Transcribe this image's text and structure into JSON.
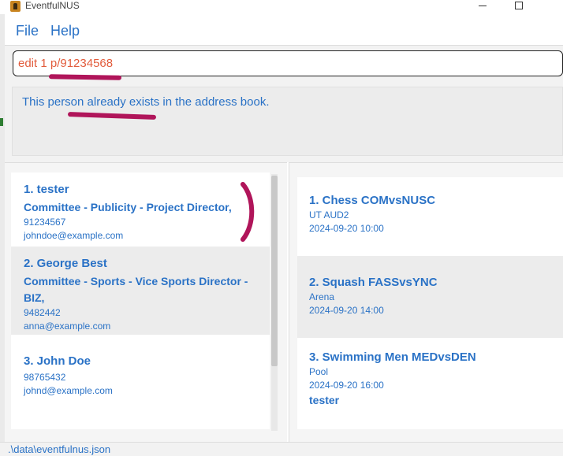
{
  "window": {
    "title": "EventfulNUS"
  },
  "menu": {
    "file": "File",
    "help": "Help"
  },
  "command": {
    "value": "edit 1 p/91234568"
  },
  "result": {
    "message": "This person already exists in the address book."
  },
  "persons": [
    {
      "name": "1. tester",
      "role": "Committee - Publicity - Project Director,",
      "phone": "91234567",
      "email": "johndoe@example.com"
    },
    {
      "name": "2. George Best",
      "role": "Committee - Sports - Vice Sports Director - BIZ,",
      "phone": "9482442",
      "email": "anna@example.com"
    },
    {
      "name": "3. John Doe",
      "role": "",
      "phone": "98765432",
      "email": "johnd@example.com"
    }
  ],
  "events": [
    {
      "title": "1. Chess COMvsNUSC",
      "venue": "UT AUD2",
      "datetime": "2024-09-20 10:00",
      "tag": ""
    },
    {
      "title": "2. Squash FASSvsYNC",
      "venue": "Arena",
      "datetime": "2024-09-20 14:00",
      "tag": ""
    },
    {
      "title": "3. Swimming Men MEDvsDEN",
      "venue": "Pool",
      "datetime": "2024-09-20 16:00",
      "tag": "tester"
    }
  ],
  "status": {
    "path": ".\\data\\eventfulnus.json"
  },
  "colors": {
    "accent": "#2a72c6",
    "command_text": "#e25c3c",
    "annotation": "#b0155a"
  },
  "icons": {
    "app": "app-icon",
    "minimize": "minimize-icon",
    "maximize": "maximize-icon"
  }
}
